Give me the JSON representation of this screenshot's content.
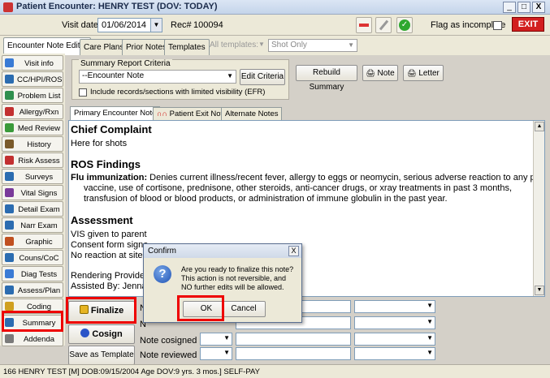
{
  "window": {
    "title": "Patient Encounter: HENRY TEST (DOV: TODAY)",
    "min": "_",
    "max": "□",
    "close": "X"
  },
  "header": {
    "visit_date_label": "Visit date:",
    "visit_date": "01/06/2014",
    "rec_label": "Rec#",
    "rec_value": "100094",
    "flag_label": "Flag as incomplete",
    "exit_label": "EXIT"
  },
  "tabs": [
    {
      "label": "Encounter Note Editor"
    },
    {
      "label": "Care Plans"
    },
    {
      "label": "Prior Notes"
    },
    {
      "label": "Templates"
    }
  ],
  "templates_filter": {
    "label": "All templates:",
    "value": "Shot Only"
  },
  "leftnav": [
    {
      "label": "Visit info"
    },
    {
      "label": "CC/HPI/ROS"
    },
    {
      "label": "Problem List"
    },
    {
      "label": "Allergy/Rxn"
    },
    {
      "label": "Med Review"
    },
    {
      "label": "History"
    },
    {
      "label": "Risk Assess"
    },
    {
      "label": "Surveys"
    },
    {
      "label": "Vital Signs"
    },
    {
      "label": "Detail Exam"
    },
    {
      "label": "Narr Exam"
    },
    {
      "label": "Graphic"
    },
    {
      "label": "Couns/CoC"
    },
    {
      "label": "Diag Tests"
    },
    {
      "label": "Assess/Plan"
    },
    {
      "label": "Coding"
    },
    {
      "label": "Summary"
    },
    {
      "label": "Addenda"
    }
  ],
  "criteria": {
    "legend": "Summary Report Criteria",
    "select_value": "--Encounter Note",
    "edit_button": "Edit Criteria",
    "include_label": "Include records/sections with limited visibility (EFR)"
  },
  "actions": {
    "rebuild": "Rebuild Summary",
    "note": "Note",
    "letter": "Letter"
  },
  "inner_tabs": [
    {
      "label": "Primary Encounter Note"
    },
    {
      "label": "Patient Exit Note"
    },
    {
      "label": "Alternate Notes"
    }
  ],
  "document": {
    "chief_heading": "Chief Complaint",
    "chief_text": "Here for shots",
    "ros_heading": "ROS Findings",
    "flu_label": "Flu immunization:",
    "flu_line1": " Denies current illness/recent fever, allergy to eggs or neomycin, serious adverse reaction to any prior",
    "flu_line2": "vaccine, use of cortisone, prednisone, other steroids, anti-cancer drugs, or xray treatments in past 3 months,",
    "flu_line3": "transfusion of blood or blood products, or administration of immune globulin in the past year.",
    "assessment_heading": "Assessment",
    "a_line1": "VIS given to parent",
    "a_line2": "Consent form signe",
    "a_line3": "No reaction at site",
    "rendering": "Rendering Provider:",
    "assisted": "Assisted By: Jenna"
  },
  "bottom": {
    "finalize": "Finalize",
    "cosign": "Cosign",
    "save_template": "Save as Template",
    "note_cosigned_label": "Note cosigned by:",
    "note_reviewed_label": "Note reviewed by:",
    "n_label": "N"
  },
  "status": "166 HENRY TEST  [M]  DOB:09/15/2004  Age DOV:9 yrs. 3 mos.]  SELF-PAY",
  "dialog": {
    "title": "Confirm",
    "close": "X",
    "message": "Are you ready to finalize this note? This action is not reversible, and NO further edits will be allowed.",
    "ok": "OK",
    "cancel": "Cancel",
    "icon": "?"
  }
}
